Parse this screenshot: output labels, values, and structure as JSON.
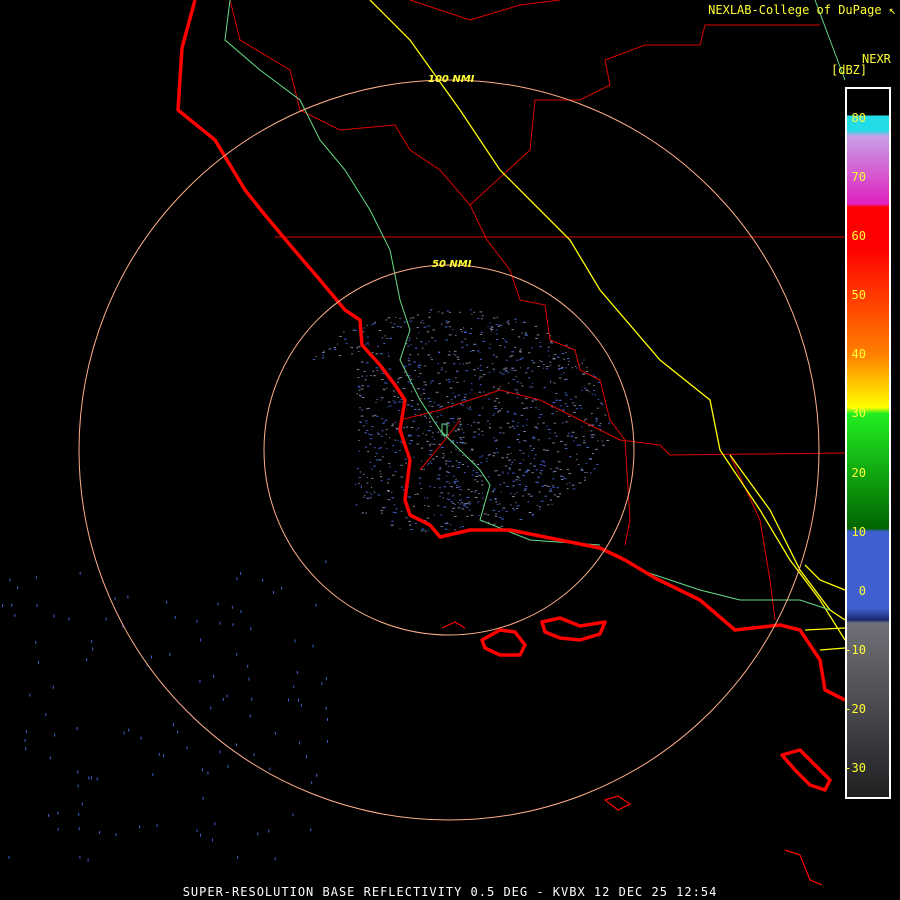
{
  "header": {
    "credit": "NEXLAB-College of DuPage ↖"
  },
  "legend": {
    "title": "NEXR",
    "units": "[dBZ]",
    "ticks": [
      "80",
      "70",
      "60",
      "50",
      "40",
      "30",
      "20",
      "10",
      "0",
      "-10",
      "-20",
      "-30"
    ],
    "tick_values": [
      80,
      70,
      60,
      50,
      40,
      30,
      20,
      10,
      0,
      -10,
      -20,
      -30
    ],
    "range": [
      -35,
      85
    ],
    "colors": {
      "cyan": "#22dde8",
      "lavender": "#c8a0e6",
      "magenta": "#e020c0",
      "red": "#ff0000",
      "orange": "#ff8000",
      "yellow": "#ffff00",
      "green": "#22ee22",
      "dark_green": "#006400",
      "blue": "#4060d0",
      "navy": "#1a2a70",
      "gray": "#707078",
      "dark_gray": "#202022"
    }
  },
  "range_rings": [
    {
      "label": "100 NMI"
    },
    {
      "label": "50 NMI"
    }
  ],
  "map_colors": {
    "coastline": "#ff0000",
    "borders": "#dd0000",
    "highways": "#ffff00",
    "rivers": "#66dd88",
    "rings": "#ffb08a",
    "echo_blue": "#4060d0",
    "echo_gray": "#8080a0"
  },
  "footer": {
    "caption": "SUPER-RESOLUTION BASE REFLECTIVITY 0.5 DEG - KVBX 12 DEC 25 12:54"
  }
}
